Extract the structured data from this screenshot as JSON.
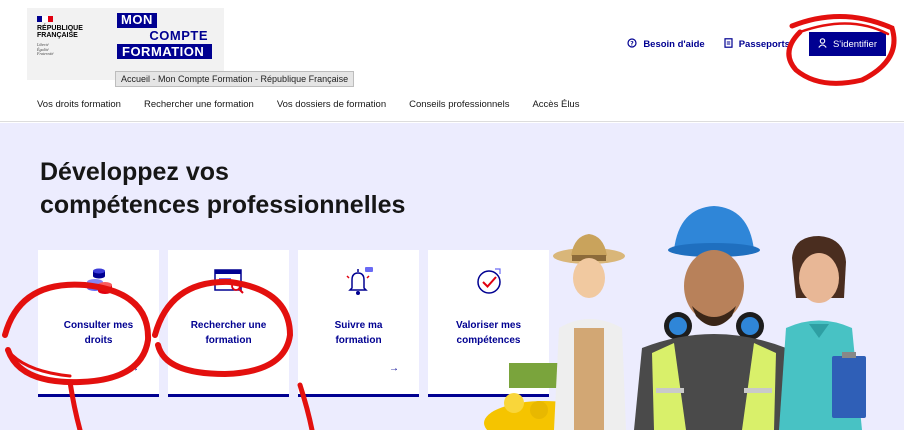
{
  "header": {
    "republic": {
      "name_line1": "RÉPUBLIQUE",
      "name_line2": "FRANÇAISE",
      "motto": [
        "Liberté",
        "Égalité",
        "Fraternité"
      ]
    },
    "brand": {
      "line1": "MON",
      "line2": "COMPTE",
      "line3": "FORMATION"
    },
    "tooltip": "Accueil - Mon Compte Formation - République Française",
    "links": {
      "help": "Besoin d'aide",
      "passports": "Passeports",
      "login": "S'identifier"
    }
  },
  "nav": {
    "items": [
      "Vos droits formation",
      "Rechercher une formation",
      "Vos dossiers de formation",
      "Conseils professionnels",
      "Accès Élus"
    ]
  },
  "hero": {
    "title_line1": "Développez vos",
    "title_line2": "compétences professionnelles",
    "cards": [
      {
        "line1": "Consulter mes",
        "line2": "droits",
        "arrow": "→"
      },
      {
        "line1": "Rechercher une",
        "line2": "formation",
        "arrow": ""
      },
      {
        "line1": "Suivre ma",
        "line2": "formation",
        "arrow": "→"
      },
      {
        "line1": "Valoriser mes",
        "line2": "compétences",
        "arrow": "↗"
      }
    ]
  },
  "colors": {
    "primary": "#000091",
    "hero_bg": "#ececfe",
    "annotation": "#e3100e",
    "flag_red": "#e1000f"
  },
  "icons": [
    "help-circle-icon",
    "document-icon",
    "user-icon",
    "coins-icon",
    "search-screen-icon",
    "bell-icon",
    "check-circle-icon"
  ]
}
